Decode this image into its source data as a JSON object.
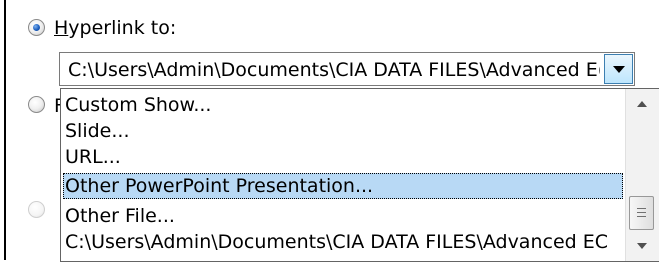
{
  "hyperlink": {
    "label_accel": "H",
    "label_rest": "yperlink to:",
    "selected": true
  },
  "combo": {
    "value": "C:\\Users\\Admin\\Documents\\CIA DATA FILES\\Advanced E("
  },
  "hidden_radio_label_fragment": "F",
  "dropdown": {
    "items": [
      {
        "label": "Custom Show..."
      },
      {
        "label": "Slide..."
      },
      {
        "label": "URL..."
      },
      {
        "label": "Other PowerPoint Presentation...",
        "selected": true
      },
      {
        "label": "Other File..."
      },
      {
        "label": "C:\\Users\\Admin\\Documents\\CIA DATA FILES\\Advanced EC"
      }
    ]
  },
  "colors": {
    "selection": "#b8d9f5",
    "radio_dot": "#1d5fbf",
    "combo_button": "#bee6fd"
  },
  "icons": [
    "radio-selected-icon",
    "radio-unselected-icon",
    "dropdown-chevron-icon",
    "scroll-up-icon",
    "scroll-down-icon"
  ]
}
